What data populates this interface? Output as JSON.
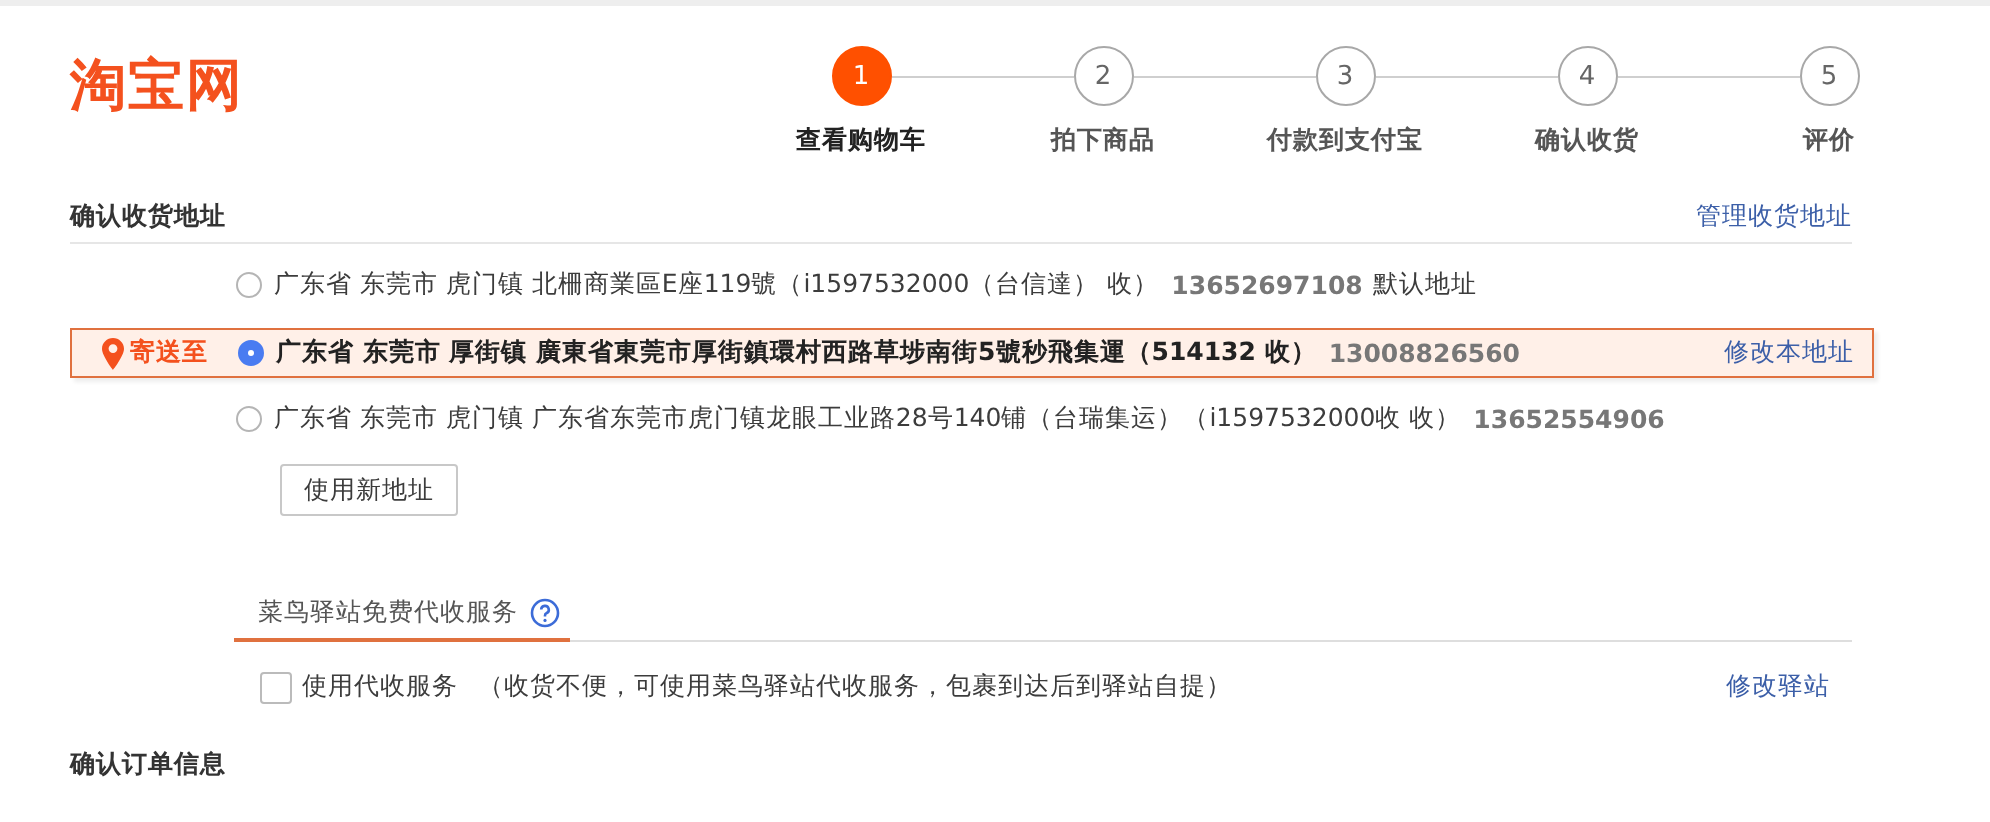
{
  "logo": "淘宝网",
  "steps": [
    {
      "number": "1",
      "label": "查看购物车",
      "selected": true
    },
    {
      "number": "2",
      "label": "拍下商品",
      "selected": false
    },
    {
      "number": "3",
      "label": "付款到支付宝",
      "selected": false
    },
    {
      "number": "4",
      "label": "确认收货",
      "selected": false
    },
    {
      "number": "5",
      "label": "评价",
      "selected": false
    }
  ],
  "address_section": {
    "title": "确认收货地址",
    "manage_link": "管理收货地址",
    "ship_to_label": "寄送至",
    "addresses": [
      {
        "selected": false,
        "address": "广东省 东莞市 虎门镇 北柵商業區E座119號",
        "recipient": "（i1597532000（台信達） 收）",
        "phone": "13652697108",
        "tag": "默认地址"
      },
      {
        "selected": true,
        "address": "广东省 东莞市 厚街镇 廣東省東莞市厚街鎮環村西路草埗南街5號秒飛集運",
        "recipient": "（514132 收）",
        "phone": "13008826560",
        "edit_link": "修改本地址"
      },
      {
        "selected": false,
        "address": "广东省 东莞市 虎门镇 广东省东莞市虎门镇龙眼工业路28号140铺（台瑞集运）",
        "recipient": "（i1597532000收 收）",
        "phone": "13652554906"
      }
    ],
    "new_address_button": "使用新地址"
  },
  "pickup_service": {
    "tab": "菜鸟驿站免费代收服务",
    "checked": false,
    "option": "使用代收服务",
    "note": "（收货不便，可使用菜鸟驿站代收服务，包裹到达后到驿站自提）",
    "edit_link": "修改驿站"
  },
  "order_section": {
    "title": "确认订单信息"
  }
}
